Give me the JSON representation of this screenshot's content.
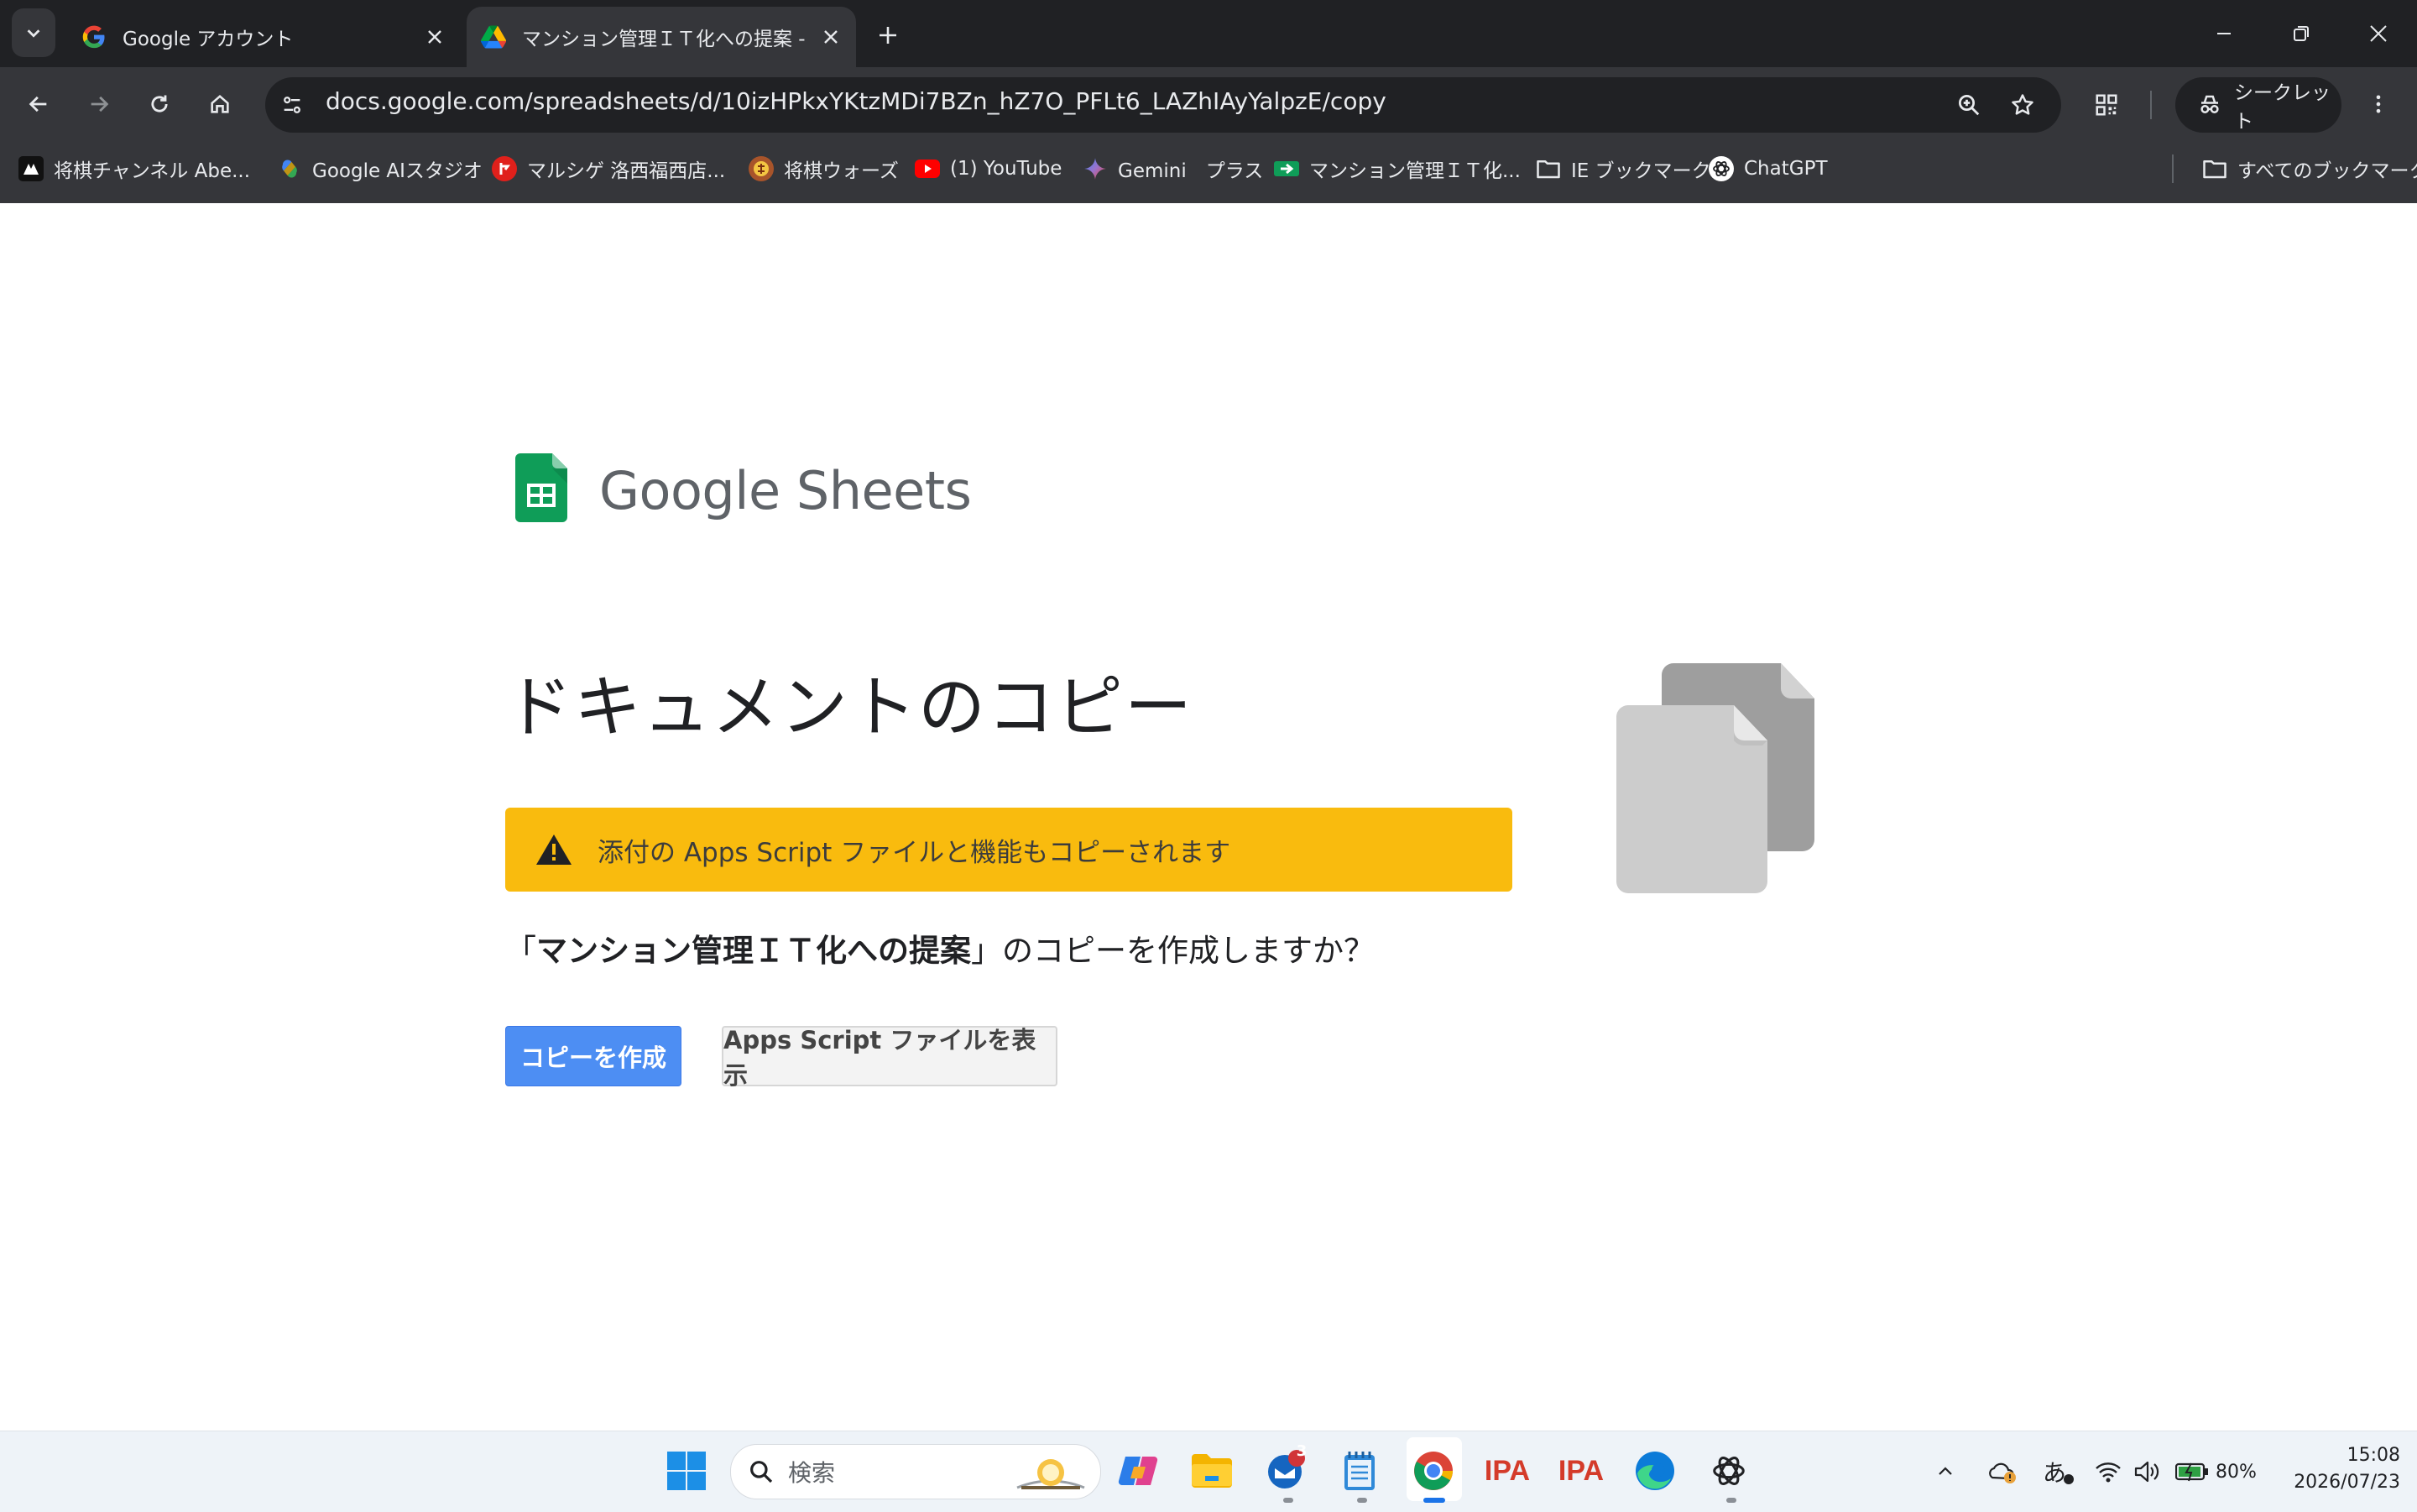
{
  "browser": {
    "tabs": [
      {
        "title": "Google アカウント",
        "icon": "google-g-icon"
      },
      {
        "title": "マンション管理ＩＴ化への提案 - コ",
        "icon": "google-drive-icon"
      }
    ],
    "url": "docs.google.com/spreadsheets/d/10izHPkxYKtzMDi7BZn_hZ7O_PFLt6_LAZhIAyYalpzE/copy",
    "incognito_label": "シークレット",
    "bookmarks": [
      {
        "label": "将棋チャンネル  Abe...",
        "icon": "abema-icon"
      },
      {
        "label": "Google AIスタジオ",
        "icon": "ai-studio-icon"
      },
      {
        "label": "マルシゲ 洛西福西店...",
        "icon": "marushige-icon"
      },
      {
        "label": "将棋ウォーズ",
        "icon": "shogi-wars-icon"
      },
      {
        "label": "(1) YouTube",
        "icon": "youtube-icon"
      },
      {
        "label": "Gemini　プラス",
        "icon": "gemini-icon"
      },
      {
        "label": "マンション管理ＩＴ化...",
        "icon": "sheets-icon"
      },
      {
        "label": "IE ブックマーク",
        "icon": "folder-icon"
      },
      {
        "label": "ChatGPT",
        "icon": "chatgpt-icon"
      }
    ],
    "all_bookmarks_label": "すべてのブックマーク"
  },
  "page": {
    "logo_text": "Google Sheets",
    "title": "ドキュメントのコピー",
    "warning": "添付の Apps Script ファイルと機能もコピーされます",
    "question_prefix": "「",
    "question_doc": "マンション管理ＩＴ化への提案",
    "question_suffix": "」のコピーを作成しますか？",
    "copy_button": "コピーを作成",
    "view_button": "Apps Script ファイルを表示"
  },
  "taskbar": {
    "search_placeholder": "検索",
    "mail_badge": "3",
    "ipa_label": "IPA",
    "battery": "80%",
    "time": "15:08",
    "date": "2026/07/23",
    "ime": "あ"
  },
  "colors": {
    "accent_button": "#4d8ef3",
    "warning": "#f9bb0e",
    "sheets_green": "#0f9d58"
  }
}
